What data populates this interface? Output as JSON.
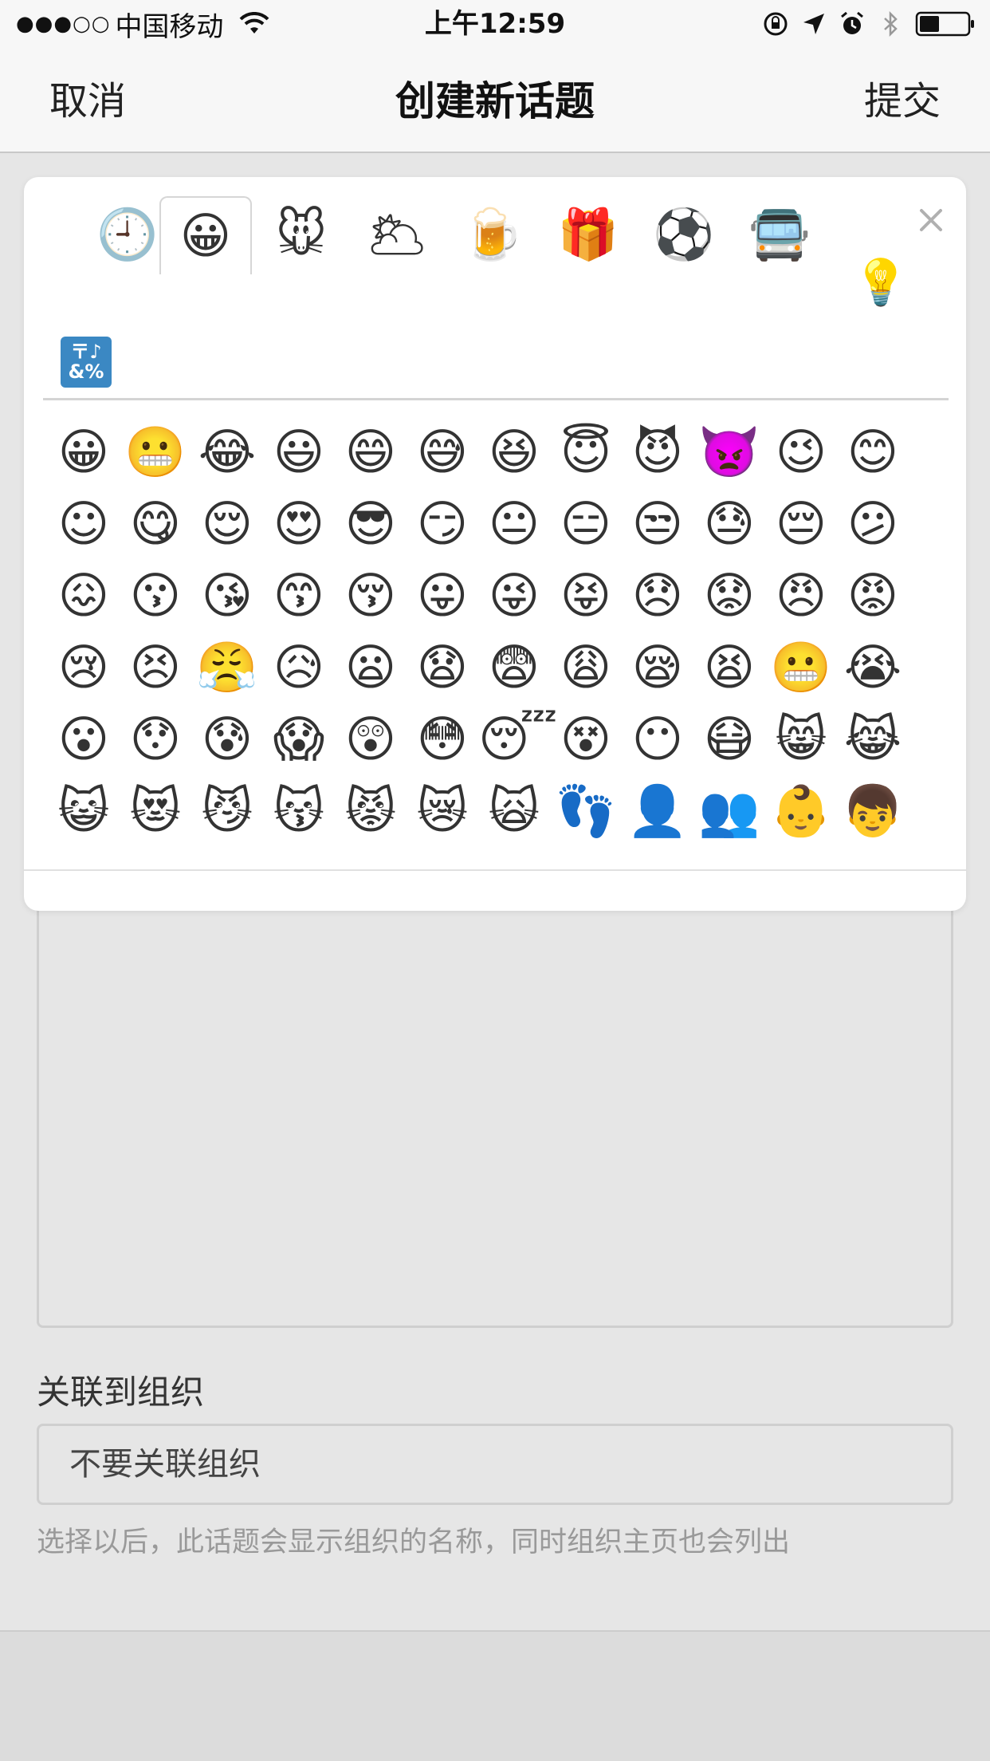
{
  "status_bar": {
    "signal": "●●●○○",
    "carrier": "中国移动",
    "time": "上午12:59"
  },
  "nav": {
    "cancel": "取消",
    "title": "创建新话题",
    "submit": "提交"
  },
  "picker": {
    "categories": [
      {
        "icon": "🕘",
        "name": "recent"
      },
      {
        "icon": "😀",
        "name": "people"
      },
      {
        "icon": "🐭",
        "name": "nature"
      },
      {
        "icon": "🌥",
        "name": "weather"
      },
      {
        "icon": "🍺",
        "name": "food"
      },
      {
        "icon": "🎁",
        "name": "celebration"
      },
      {
        "icon": "⚽",
        "name": "activity"
      },
      {
        "icon": "🚍",
        "name": "travel"
      }
    ],
    "extra_category_icon": "💡",
    "symbols_tab": [
      "〒♪",
      "&%"
    ],
    "emoji_rows": [
      [
        "😀",
        "😬",
        "😂",
        "😃",
        "😄",
        "😅",
        "😆",
        "😇",
        "😈",
        "👿",
        "😉",
        "😊"
      ],
      [
        "☺",
        "😋",
        "😌",
        "😍",
        "😎",
        "😏",
        "😐",
        "😑",
        "😒",
        "😓",
        "😔",
        "😕"
      ],
      [
        "😖",
        "😗",
        "😘",
        "😙",
        "😚",
        "😛",
        "😜",
        "😝",
        "😞",
        "😟",
        "😠",
        "😡"
      ],
      [
        "😢",
        "😣",
        "😤",
        "😥",
        "😦",
        "😧",
        "😨",
        "😩",
        "😪",
        "😫",
        "😬",
        "😭"
      ],
      [
        "😮",
        "😯",
        "😰",
        "😱",
        "😲",
        "😳",
        "😴",
        "😵",
        "😶",
        "😷",
        "😸",
        "😹"
      ],
      [
        "😺",
        "😻",
        "😼",
        "😽",
        "😾",
        "😿",
        "🙀",
        "👣",
        "👤",
        "👥",
        "👶",
        "👦"
      ]
    ]
  },
  "form": {
    "org_label": "关联到组织",
    "org_value": "不要关联组织",
    "org_hint": "选择以后，此话题会显示组织的名称，同时组织主页也会列出"
  }
}
